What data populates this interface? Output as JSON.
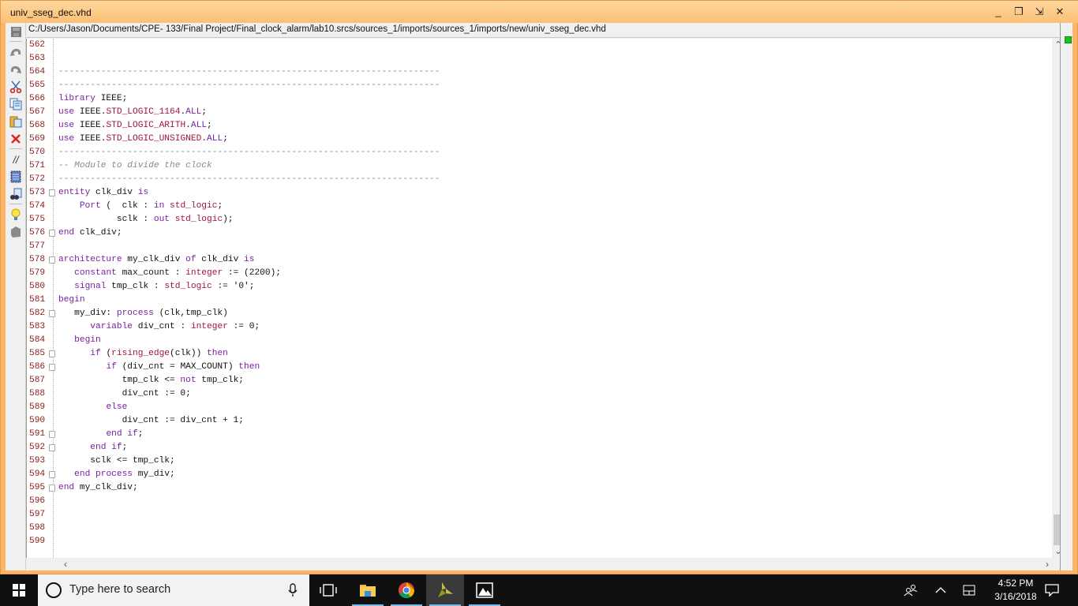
{
  "window": {
    "title": "univ_sseg_dec.vhd",
    "path": "C:/Users/Jason/Documents/CPE- 133/Final Project/Final_clock_alarm/lab10.srcs/sources_1/imports/sources_1/imports/new/univ_sseg_dec.vhd",
    "controls": {
      "minimize": "_",
      "restore": "❐",
      "float": "⇲",
      "close": "✕"
    }
  },
  "toolbar": {
    "items": [
      {
        "name": "save",
        "icon": "save-icon"
      },
      {
        "name": "undo",
        "icon": "undo-icon"
      },
      {
        "name": "redo",
        "icon": "redo-icon"
      },
      {
        "name": "cut",
        "icon": "scissors-icon"
      },
      {
        "name": "copy",
        "icon": "copy-icon"
      },
      {
        "name": "paste",
        "icon": "paste-icon"
      },
      {
        "name": "delete",
        "icon": "delete-icon"
      },
      {
        "name": "comment",
        "icon": "comment-toggle-icon",
        "glyph": "//"
      },
      {
        "name": "select-all",
        "icon": "select-all-icon"
      },
      {
        "name": "find",
        "icon": "binoculars-icon"
      },
      {
        "name": "hint",
        "icon": "lightbulb-icon"
      },
      {
        "name": "template",
        "icon": "template-icon"
      }
    ]
  },
  "editor": {
    "lines": [
      {
        "n": "562",
        "fold": "",
        "tokens": []
      },
      {
        "n": "563",
        "fold": "",
        "tokens": []
      },
      {
        "n": "564",
        "fold": "",
        "tokens": [
          [
            "dash",
            "------------------------------------------------------------------------"
          ]
        ]
      },
      {
        "n": "565",
        "fold": "",
        "tokens": [
          [
            "dash",
            "------------------------------------------------------------------------"
          ]
        ]
      },
      {
        "n": "566",
        "fold": "",
        "tokens": [
          [
            "kw",
            "library"
          ],
          [
            "",
            " IEEE;"
          ]
        ]
      },
      {
        "n": "567",
        "fold": "",
        "tokens": [
          [
            "kw",
            "use"
          ],
          [
            "",
            " IEEE."
          ],
          [
            "ty",
            "STD_LOGIC_1164"
          ],
          [
            "",
            "."
          ],
          [
            "kw",
            "ALL"
          ],
          [
            "",
            ";"
          ]
        ]
      },
      {
        "n": "568",
        "fold": "",
        "tokens": [
          [
            "kw",
            "use"
          ],
          [
            "",
            " IEEE."
          ],
          [
            "ty",
            "STD_LOGIC_ARITH"
          ],
          [
            "",
            "."
          ],
          [
            "kw",
            "ALL"
          ],
          [
            "",
            ";"
          ]
        ]
      },
      {
        "n": "569",
        "fold": "",
        "tokens": [
          [
            "kw",
            "use"
          ],
          [
            "",
            " IEEE."
          ],
          [
            "ty",
            "STD_LOGIC_UNSIGNED"
          ],
          [
            "",
            "."
          ],
          [
            "kw",
            "ALL"
          ],
          [
            "",
            ";"
          ]
        ]
      },
      {
        "n": "570",
        "fold": "",
        "tokens": [
          [
            "dash",
            "------------------------------------------------------------------------"
          ]
        ]
      },
      {
        "n": "571",
        "fold": "",
        "tokens": [
          [
            "cm",
            "-- Module to divide the clock"
          ]
        ]
      },
      {
        "n": "572",
        "fold": "",
        "tokens": [
          [
            "dash",
            "------------------------------------------------------------------------"
          ]
        ]
      },
      {
        "n": "573",
        "fold": "open",
        "tokens": [
          [
            "kw",
            "entity"
          ],
          [
            "",
            " clk_div "
          ],
          [
            "kw",
            "is"
          ]
        ]
      },
      {
        "n": "574",
        "fold": "",
        "tokens": [
          [
            "",
            "    "
          ],
          [
            "kw",
            "Port"
          ],
          [
            "",
            " (  clk : "
          ],
          [
            "kw",
            "in"
          ],
          [
            "",
            " "
          ],
          [
            "ty",
            "std_logic"
          ],
          [
            "",
            ";"
          ]
        ]
      },
      {
        "n": "575",
        "fold": "",
        "tokens": [
          [
            "",
            "           sclk : "
          ],
          [
            "kw",
            "out"
          ],
          [
            "",
            " "
          ],
          [
            "ty",
            "std_logic"
          ],
          [
            "",
            ");"
          ]
        ]
      },
      {
        "n": "576",
        "fold": "close",
        "tokens": [
          [
            "kw",
            "end"
          ],
          [
            "",
            " clk_div;"
          ]
        ]
      },
      {
        "n": "577",
        "fold": "",
        "tokens": []
      },
      {
        "n": "578",
        "fold": "open",
        "tokens": [
          [
            "kw",
            "architecture"
          ],
          [
            "",
            " my_clk_div "
          ],
          [
            "kw",
            "of"
          ],
          [
            "",
            " clk_div "
          ],
          [
            "kw",
            "is"
          ]
        ]
      },
      {
        "n": "579",
        "fold": "",
        "tokens": [
          [
            "",
            "   "
          ],
          [
            "kw",
            "constant"
          ],
          [
            "",
            " max_count : "
          ],
          [
            "ty",
            "integer"
          ],
          [
            "",
            " := (2200);"
          ]
        ]
      },
      {
        "n": "580",
        "fold": "",
        "tokens": [
          [
            "",
            "   "
          ],
          [
            "kw",
            "signal"
          ],
          [
            "",
            " tmp_clk : "
          ],
          [
            "ty",
            "std_logic"
          ],
          [
            "",
            " := '0';"
          ]
        ]
      },
      {
        "n": "581",
        "fold": "",
        "tokens": [
          [
            "kw",
            "begin"
          ]
        ]
      },
      {
        "n": "582",
        "fold": "open",
        "tokens": [
          [
            "",
            "   my_div: "
          ],
          [
            "kw",
            "process"
          ],
          [
            "",
            " (clk,tmp_clk)"
          ]
        ]
      },
      {
        "n": "583",
        "fold": "",
        "tokens": [
          [
            "",
            "      "
          ],
          [
            "kw",
            "variable"
          ],
          [
            "",
            " div_cnt : "
          ],
          [
            "ty",
            "integer"
          ],
          [
            "",
            " := 0;"
          ]
        ]
      },
      {
        "n": "584",
        "fold": "",
        "tokens": [
          [
            "",
            "   "
          ],
          [
            "kw",
            "begin"
          ]
        ]
      },
      {
        "n": "585",
        "fold": "open",
        "tokens": [
          [
            "",
            "      "
          ],
          [
            "kw",
            "if"
          ],
          [
            "",
            " ("
          ],
          [
            "ty",
            "rising_edge"
          ],
          [
            "",
            "(clk)) "
          ],
          [
            "kw",
            "then"
          ]
        ]
      },
      {
        "n": "586",
        "fold": "open",
        "tokens": [
          [
            "",
            "         "
          ],
          [
            "kw",
            "if"
          ],
          [
            "",
            " (div_cnt = MAX_COUNT) "
          ],
          [
            "kw",
            "then"
          ]
        ]
      },
      {
        "n": "587",
        "fold": "",
        "tokens": [
          [
            "",
            "            tmp_clk <= "
          ],
          [
            "kw",
            "not"
          ],
          [
            "",
            " tmp_clk;"
          ]
        ]
      },
      {
        "n": "588",
        "fold": "",
        "tokens": [
          [
            "",
            "            div_cnt := 0;"
          ]
        ]
      },
      {
        "n": "589",
        "fold": "",
        "tokens": [
          [
            "",
            "         "
          ],
          [
            "kw",
            "else"
          ]
        ]
      },
      {
        "n": "590",
        "fold": "",
        "tokens": [
          [
            "",
            "            div_cnt := div_cnt + 1;"
          ]
        ]
      },
      {
        "n": "591",
        "fold": "close",
        "tokens": [
          [
            "",
            "         "
          ],
          [
            "kw",
            "end if"
          ],
          [
            "",
            ";"
          ]
        ]
      },
      {
        "n": "592",
        "fold": "close",
        "tokens": [
          [
            "",
            "      "
          ],
          [
            "kw",
            "end if"
          ],
          [
            "",
            ";"
          ]
        ]
      },
      {
        "n": "593",
        "fold": "",
        "tokens": [
          [
            "",
            "      sclk <= tmp_clk;"
          ]
        ]
      },
      {
        "n": "594",
        "fold": "close",
        "tokens": [
          [
            "",
            "   "
          ],
          [
            "kw",
            "end process"
          ],
          [
            "",
            " my_div;"
          ]
        ]
      },
      {
        "n": "595",
        "fold": "close",
        "tokens": [
          [
            "kw",
            "end"
          ],
          [
            "",
            " my_clk_div;"
          ]
        ]
      },
      {
        "n": "596",
        "fold": "",
        "tokens": []
      },
      {
        "n": "597",
        "fold": "",
        "tokens": []
      },
      {
        "n": "598",
        "fold": "",
        "tokens": []
      },
      {
        "n": "599",
        "fold": "",
        "tokens": []
      }
    ],
    "vertical_scroll_fraction": 0.95
  },
  "taskbar": {
    "search_placeholder": "Type here to search",
    "apps": [
      {
        "name": "task-view",
        "icon": "task-view-icon"
      },
      {
        "name": "file-explorer",
        "icon": "folder-icon",
        "running": true
      },
      {
        "name": "chrome",
        "icon": "chrome-icon",
        "running": true
      },
      {
        "name": "vivado",
        "icon": "vivado-icon",
        "running": true,
        "active": true
      },
      {
        "name": "photos",
        "icon": "photos-icon",
        "running": true
      }
    ],
    "clock": {
      "time": "4:52 PM",
      "date": "3/16/2018"
    }
  },
  "colors": {
    "window_frame": "#fcb465",
    "keyword": "#7a1fa2",
    "type": "#a0153e",
    "comment": "#8a8a8a",
    "line_number": "#8b1a1a",
    "status_ok": "#18c418"
  }
}
